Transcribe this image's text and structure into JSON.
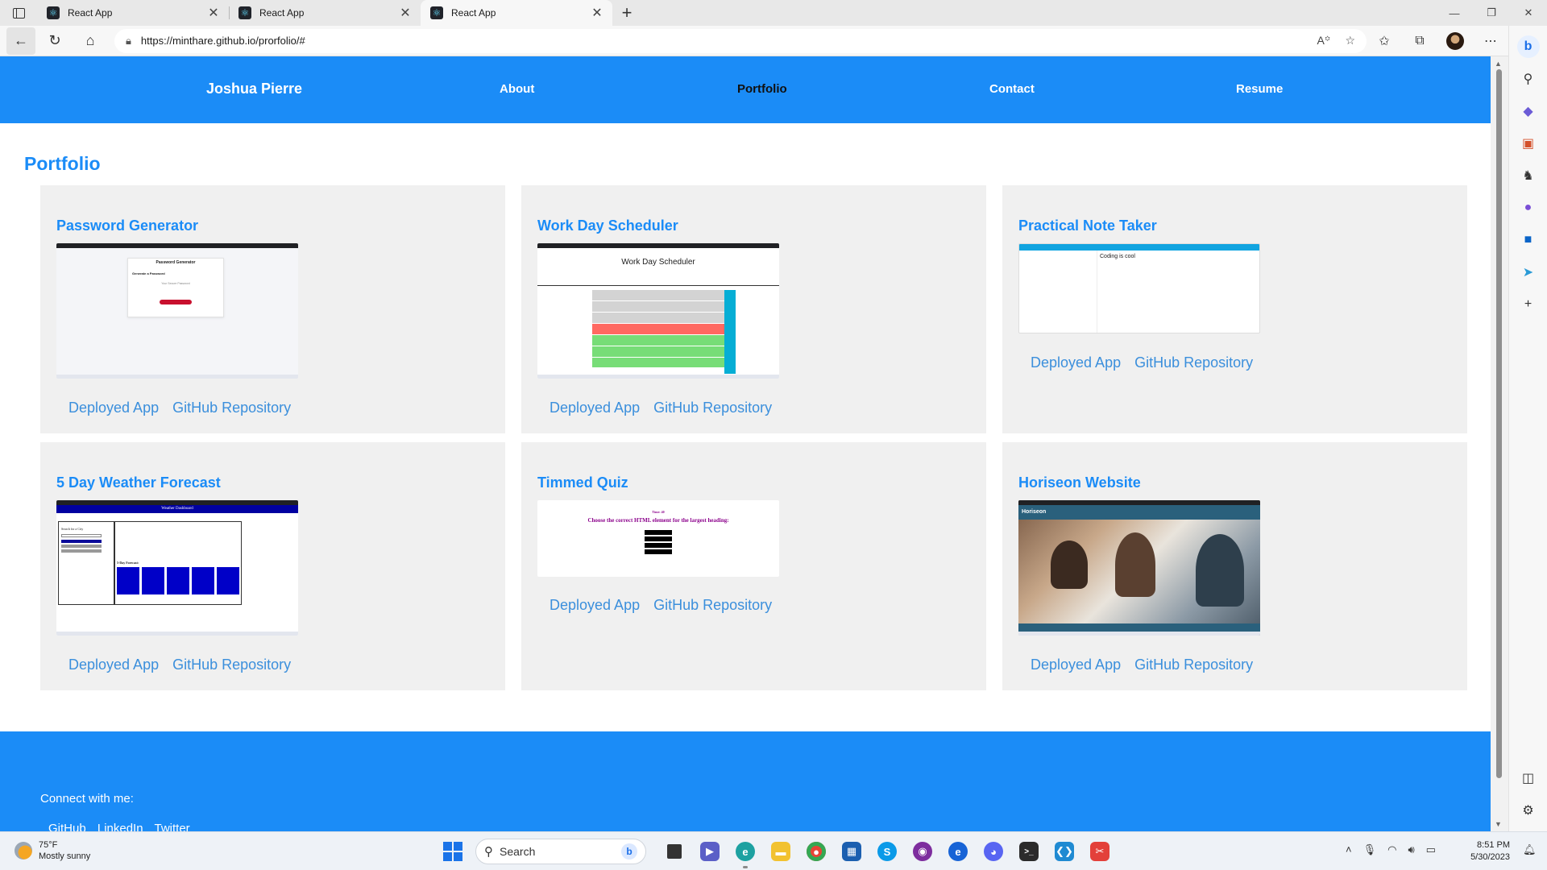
{
  "browser": {
    "tabs": [
      {
        "title": "React App",
        "active": false
      },
      {
        "title": "React App",
        "active": false
      },
      {
        "title": "React App",
        "active": true
      }
    ],
    "url": "https://minthare.github.io/prorfolio/#"
  },
  "site": {
    "brand": "Joshua Pierre",
    "nav": [
      {
        "label": "About"
      },
      {
        "label": "Portfolio"
      },
      {
        "label": "Contact"
      },
      {
        "label": "Resume"
      }
    ],
    "page_title": "Portfolio",
    "projects": [
      {
        "title": "Password Generator",
        "deployed": "Deployed App",
        "repo": "GitHub Repository"
      },
      {
        "title": "Work Day Scheduler",
        "deployed": "Deployed App",
        "repo": "GitHub Repository"
      },
      {
        "title": "Practical Note Taker",
        "deployed": "Deployed App",
        "repo": "GitHub Repository"
      },
      {
        "title": "5 Day Weather Forecast",
        "deployed": "Deployed App",
        "repo": "GitHub Repository"
      },
      {
        "title": "Timmed Quiz",
        "deployed": "Deployed App",
        "repo": "GitHub Repository"
      },
      {
        "title": "Horiseon Website",
        "deployed": "Deployed App",
        "repo": "GitHub Repository"
      }
    ],
    "thumbs": {
      "password_title": "Password Generator",
      "password_sub": "Generate a Password",
      "password_field": "Your Secure Password",
      "scheduler_title": "Work Day Scheduler",
      "note_text": "Coding is cool",
      "weather_title": "Weather Dashboard",
      "weather_search": "Search for a City",
      "weather_forecast": "5-Day Forecast:",
      "quiz_timer": "Time: 40",
      "quiz_question": "Choose the correct HTML element for the largest heading:",
      "horiseon_brand": "Horiseon"
    },
    "footer": {
      "label": "Connect with me:",
      "links": [
        "GitHub",
        "LinkedIn",
        "Twitter"
      ]
    }
  },
  "taskbar": {
    "weather_temp": "75°F",
    "weather_desc": "Mostly sunny",
    "search_placeholder": "Search",
    "time": "8:51 PM",
    "date": "5/30/2023"
  },
  "colors": {
    "accent": "#1b8cf7",
    "card_bg": "#f0f0f0",
    "link": "#3b8fdc"
  }
}
